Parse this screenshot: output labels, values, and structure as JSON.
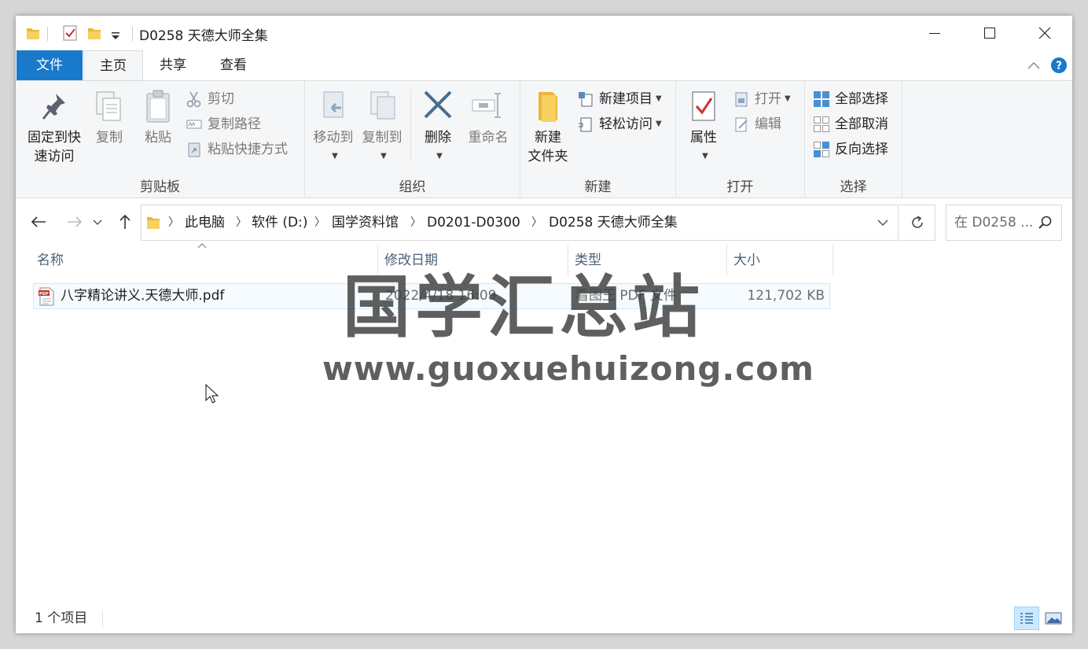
{
  "window": {
    "title": "D0258 天德大师全集",
    "controls": [
      "minimize",
      "maximize",
      "close"
    ]
  },
  "ribbon_tabs": [
    {
      "label": "文件"
    },
    {
      "label": "主页"
    },
    {
      "label": "共享"
    },
    {
      "label": "查看"
    }
  ],
  "ribbon": {
    "clipboard": {
      "label": "剪贴板",
      "pin": "固定到快",
      "pin2": "速访问",
      "copy": "复制",
      "paste": "粘贴",
      "cut": "剪切",
      "copy_path": "复制路径",
      "paste_shortcut": "粘贴快捷方式"
    },
    "organize": {
      "label": "组织",
      "move_to": "移动到",
      "copy_to": "复制到",
      "delete": "删除",
      "rename": "重命名"
    },
    "new": {
      "label": "新建",
      "new_folder": "新建",
      "new_folder2": "文件夹",
      "new_item": "新建项目",
      "easy_access": "轻松访问"
    },
    "open": {
      "label": "打开",
      "properties": "属性",
      "open": "打开",
      "edit": "编辑"
    },
    "select": {
      "label": "选择",
      "select_all": "全部选择",
      "select_none": "全部取消",
      "invert": "反向选择"
    }
  },
  "address": {
    "crumbs": [
      "此电脑",
      "软件 (D:)",
      "国学资料馆",
      "D0201-D0300",
      "D0258 天德大师全集"
    ],
    "search_placeholder": "在 D0258 ..."
  },
  "columns": {
    "name": "名称",
    "date": "修改日期",
    "type": "类型",
    "size": "大小"
  },
  "files": [
    {
      "name": "八字精论讲义.天德大师.pdf",
      "date": "2022/4/18 16:09",
      "type": "看图王 PDF 文件",
      "size": "121,702 KB"
    }
  ],
  "watermark": {
    "line1": "国学汇总站",
    "line2": "www.guoxuehuizong.com"
  },
  "status": {
    "count": "1 个项目"
  },
  "colors": {
    "file_tab": "#1979ca",
    "selection": "#cce8ff",
    "header_text": "#4c607a"
  }
}
